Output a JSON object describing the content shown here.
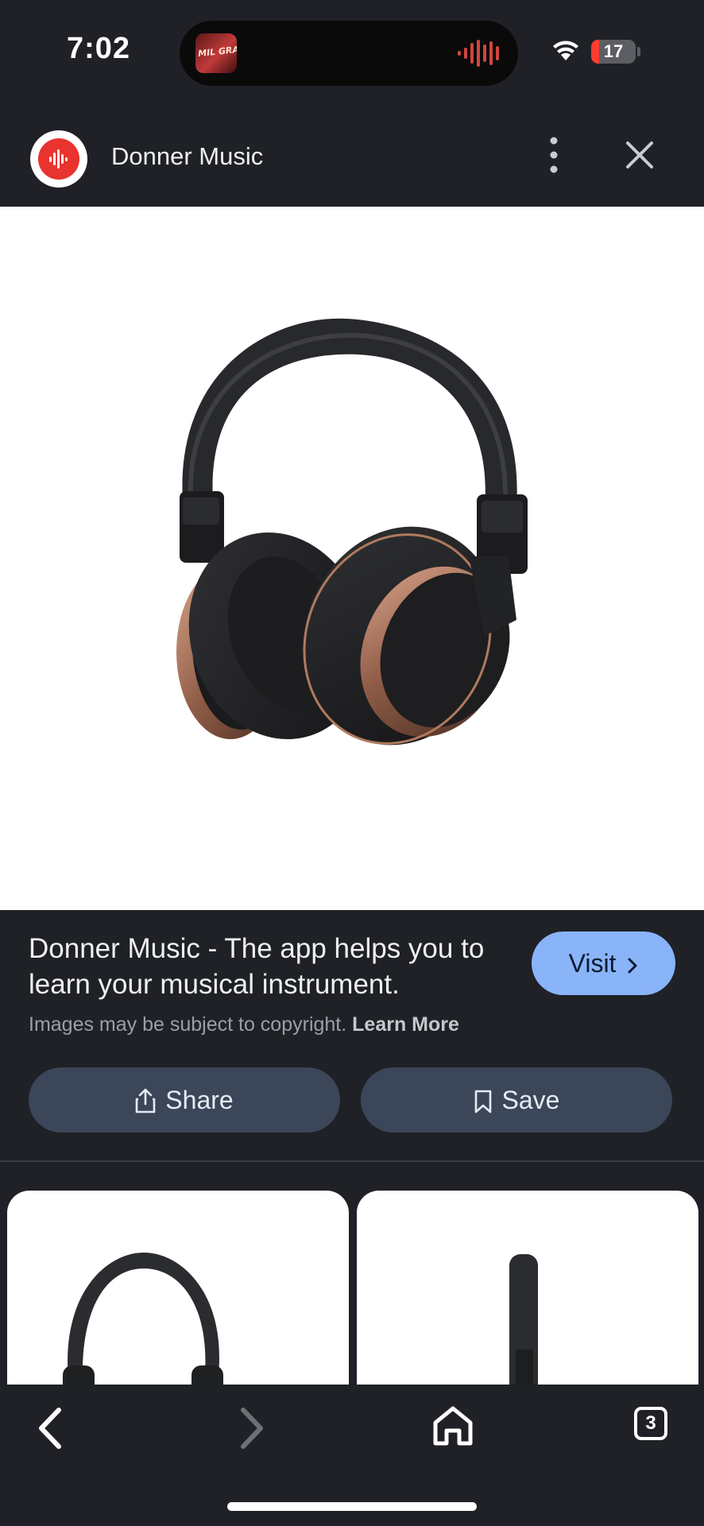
{
  "status_bar": {
    "time": "7:02",
    "now_playing_art_text": "MIL GRACIAS",
    "battery_level": "17",
    "battery_fraction": 0.17
  },
  "header": {
    "title": "Donner Music",
    "logo_icon": "donner-music-logo-icon",
    "more_icon": "more-vert-icon",
    "close_icon": "close-icon"
  },
  "info": {
    "description": "Donner Music - The app helps you to learn your musical instrument.",
    "visit_label": "Visit",
    "copyright_text": "Images may be subject to copyright.",
    "learn_more_label": "Learn More",
    "share_label": "Share",
    "save_label": "Save"
  },
  "bottom_nav": {
    "tab_count": "3"
  },
  "colors": {
    "background": "#1f2126",
    "accent": "#8ab4f8",
    "pill": "#3b4659",
    "brand_red": "#e8332e"
  }
}
